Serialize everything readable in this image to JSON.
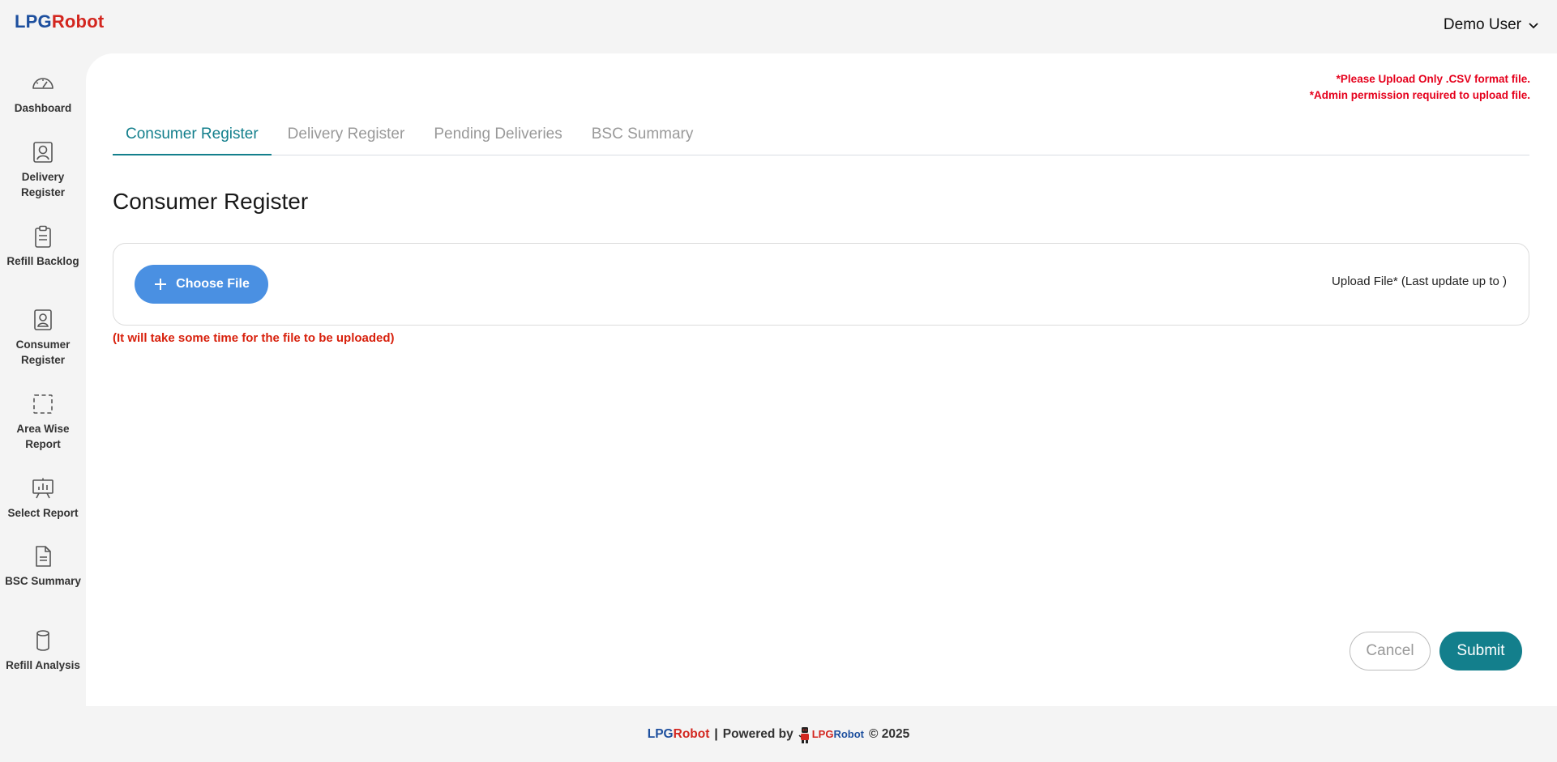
{
  "header": {
    "logo_lpg": "LPG",
    "logo_robot": "Robot",
    "user_name": "Demo User",
    "user_menu_icon": "chevron-down-icon"
  },
  "sidebar": {
    "items": [
      {
        "label": "Dashboard",
        "icon": "gauge-icon"
      },
      {
        "label": "Delivery Register",
        "icon": "user-portrait-icon"
      },
      {
        "label": "Refill Backlog",
        "icon": "clipboard-icon"
      },
      {
        "label": "Consumer Register",
        "icon": "contact-badge-icon"
      },
      {
        "label": "Area Wise Report",
        "icon": "dashed-square-icon"
      },
      {
        "label": "Select Report",
        "icon": "presentation-chart-icon"
      },
      {
        "label": "BSC Summary",
        "icon": "document-icon"
      },
      {
        "label": "Refill Analysis",
        "icon": "cylinder-icon"
      }
    ]
  },
  "main": {
    "notes": {
      "line1": "*Please Upload Only .CSV format file.",
      "line2": "*Admin permission required to upload file."
    },
    "tabs": [
      {
        "label": "Consumer Register",
        "active": true
      },
      {
        "label": "Delivery Register",
        "active": false
      },
      {
        "label": "Pending Deliveries",
        "active": false
      },
      {
        "label": "BSC Summary",
        "active": false
      }
    ],
    "title": "Consumer Register",
    "upload": {
      "button_label": "Choose File",
      "button_icon": "plus-icon",
      "label": "Upload File* (Last update up to )",
      "hint": "(It will take some time for the file to be uploaded)"
    },
    "actions": {
      "cancel": "Cancel",
      "submit": "Submit"
    }
  },
  "footer": {
    "brand_lpg": "LPG",
    "brand_robot": "Robot",
    "separator": "|",
    "powered_by": "Powered by",
    "mini_lpg": "LPG",
    "mini_robot": "Robot",
    "copyright": "© 2025"
  },
  "colors": {
    "accent": "#137f8c",
    "choose_button": "#4a90e2",
    "warning": "#e5001c",
    "brand_blue": "#1d4f9e",
    "brand_red": "#d3261f"
  }
}
